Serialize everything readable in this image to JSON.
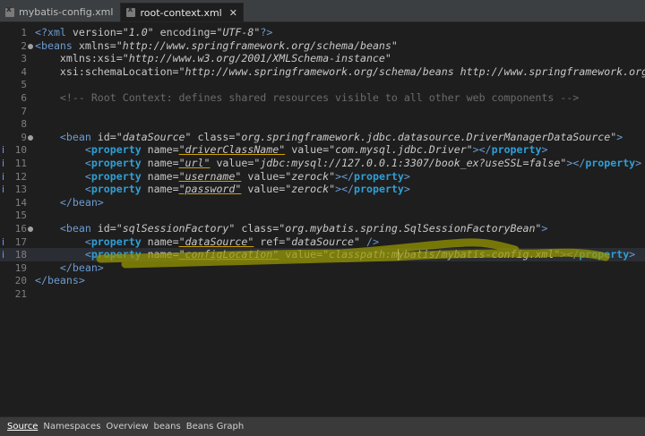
{
  "tabs": [
    {
      "label": "mybatis-config.xml",
      "active": false
    },
    {
      "label": "root-context.xml",
      "active": true
    }
  ],
  "close_glyph": "✕",
  "editor": {
    "lines": [
      {
        "n": "1",
        "fold": false,
        "mark": "",
        "html": [
          [
            "pi",
            "<?"
          ],
          [
            "b",
            "xml"
          ],
          [
            "a",
            " version="
          ],
          [
            "v",
            "\"1.0\""
          ],
          [
            "a",
            " encoding="
          ],
          [
            "v",
            "\"UTF-8\""
          ],
          [
            "pi",
            "?>"
          ]
        ]
      },
      {
        "n": "2",
        "fold": true,
        "mark": "",
        "html": [
          [
            "b",
            "<beans"
          ],
          [
            "a",
            " xmlns="
          ],
          [
            "v",
            "\"http://www.springframework.org/schema/beans\""
          ]
        ]
      },
      {
        "n": "3",
        "fold": false,
        "mark": "",
        "html": [
          [
            "a",
            "    xmlns:xsi="
          ],
          [
            "v",
            "\"http://www.w3.org/2001/XMLSchema-instance\""
          ]
        ]
      },
      {
        "n": "4",
        "fold": false,
        "mark": "",
        "html": [
          [
            "a",
            "    xsi:schemaLocation="
          ],
          [
            "v",
            "\"http://www.springframework.org/schema/beans http://www.springframework.org/schema/beans/spring-beans.xsd\""
          ],
          [
            "b",
            ">"
          ]
        ]
      },
      {
        "n": "5",
        "fold": false,
        "mark": "",
        "html": []
      },
      {
        "n": "6",
        "fold": false,
        "mark": "",
        "html": [
          [
            "c",
            "    <!-- Root Context: defines shared resources visible to all other web components -->"
          ]
        ]
      },
      {
        "n": "7",
        "fold": false,
        "mark": "",
        "html": []
      },
      {
        "n": "8",
        "fold": false,
        "mark": "",
        "html": []
      },
      {
        "n": "9",
        "fold": true,
        "mark": "",
        "html": [
          [
            "a",
            "    "
          ],
          [
            "b",
            "<bean"
          ],
          [
            "a",
            " id="
          ],
          [
            "v",
            "\"dataSource\""
          ],
          [
            "a",
            " class="
          ],
          [
            "v",
            "\"org.springframework.jdbc.datasource.DriverManagerDataSource\""
          ],
          [
            "b",
            ">"
          ]
        ]
      },
      {
        "n": "10",
        "fold": false,
        "mark": "i",
        "html": [
          [
            "a",
            "        "
          ],
          [
            "b",
            "<"
          ],
          [
            "tag",
            "property"
          ],
          [
            "a",
            " name="
          ],
          [
            "u",
            "\"driverClassName\""
          ],
          [
            "a",
            " value="
          ],
          [
            "v",
            "\"com.mysql.jdbc.Driver\""
          ],
          [
            "b",
            "></"
          ],
          [
            "tag",
            "property"
          ],
          [
            "b",
            ">"
          ]
        ]
      },
      {
        "n": "11",
        "fold": false,
        "mark": "i",
        "html": [
          [
            "a",
            "        "
          ],
          [
            "b",
            "<"
          ],
          [
            "tag",
            "property"
          ],
          [
            "a",
            " name="
          ],
          [
            "u",
            "\"url\""
          ],
          [
            "a",
            " value="
          ],
          [
            "v",
            "\"jdbc:mysql://127.0.0.1:3307/book_ex?useSSL=false\""
          ],
          [
            "b",
            "></"
          ],
          [
            "tag",
            "property"
          ],
          [
            "b",
            ">"
          ]
        ]
      },
      {
        "n": "12",
        "fold": false,
        "mark": "i",
        "html": [
          [
            "a",
            "        "
          ],
          [
            "b",
            "<"
          ],
          [
            "tag",
            "property"
          ],
          [
            "a",
            " name="
          ],
          [
            "u",
            "\"username\""
          ],
          [
            "a",
            " value="
          ],
          [
            "v",
            "\"zerock\""
          ],
          [
            "b",
            "></"
          ],
          [
            "tag",
            "property"
          ],
          [
            "b",
            ">"
          ]
        ]
      },
      {
        "n": "13",
        "fold": false,
        "mark": "i",
        "html": [
          [
            "a",
            "        "
          ],
          [
            "b",
            "<"
          ],
          [
            "tag",
            "property"
          ],
          [
            "a",
            " name="
          ],
          [
            "u",
            "\"password\""
          ],
          [
            "a",
            " value="
          ],
          [
            "v",
            "\"zerock\""
          ],
          [
            "b",
            "></"
          ],
          [
            "tag",
            "property"
          ],
          [
            "b",
            ">"
          ]
        ]
      },
      {
        "n": "14",
        "fold": false,
        "mark": "",
        "html": [
          [
            "a",
            "    "
          ],
          [
            "b",
            "</bean>"
          ]
        ]
      },
      {
        "n": "15",
        "fold": false,
        "mark": "",
        "html": []
      },
      {
        "n": "16",
        "fold": true,
        "mark": "",
        "html": [
          [
            "a",
            "    "
          ],
          [
            "b",
            "<bean"
          ],
          [
            "a",
            " id="
          ],
          [
            "v",
            "\"sqlSessionFactory\""
          ],
          [
            "a",
            " class="
          ],
          [
            "v",
            "\"org.mybatis.spring.SqlSessionFactoryBean\""
          ],
          [
            "b",
            ">"
          ]
        ]
      },
      {
        "n": "17",
        "fold": false,
        "mark": "i",
        "html": [
          [
            "a",
            "        "
          ],
          [
            "b",
            "<"
          ],
          [
            "tag",
            "property"
          ],
          [
            "a",
            " name="
          ],
          [
            "u",
            "\"dataSource\""
          ],
          [
            "a",
            " ref="
          ],
          [
            "v",
            "\"dataSource\""
          ],
          [
            "b",
            " />"
          ]
        ]
      },
      {
        "n": "18",
        "fold": false,
        "mark": "i",
        "html": [
          [
            "a",
            "        "
          ],
          [
            "b",
            "<"
          ],
          [
            "tag",
            "property"
          ],
          [
            "a",
            " name="
          ],
          [
            "u",
            "\"configLocation\""
          ],
          [
            "a",
            " value="
          ],
          [
            "v",
            "\"classpath:mybatis/mybatis-config.xml\""
          ],
          [
            "b",
            "></"
          ],
          [
            "tag",
            "property"
          ],
          [
            "b",
            ">"
          ]
        ]
      },
      {
        "n": "19",
        "fold": false,
        "mark": "",
        "html": [
          [
            "a",
            "    "
          ],
          [
            "b",
            "</bean>"
          ]
        ]
      },
      {
        "n": "20",
        "fold": false,
        "mark": "",
        "html": [
          [
            "b",
            "</beans>"
          ]
        ]
      },
      {
        "n": "21",
        "fold": false,
        "mark": "",
        "html": []
      }
    ],
    "current_line": 18,
    "highlight_color": "#9a9a00"
  },
  "bottom_tabs": [
    {
      "label": "Source",
      "active": true
    },
    {
      "label": "Namespaces",
      "active": false
    },
    {
      "label": "Overview",
      "active": false
    },
    {
      "label": "beans",
      "active": false
    },
    {
      "label": "Beans Graph",
      "active": false
    }
  ]
}
